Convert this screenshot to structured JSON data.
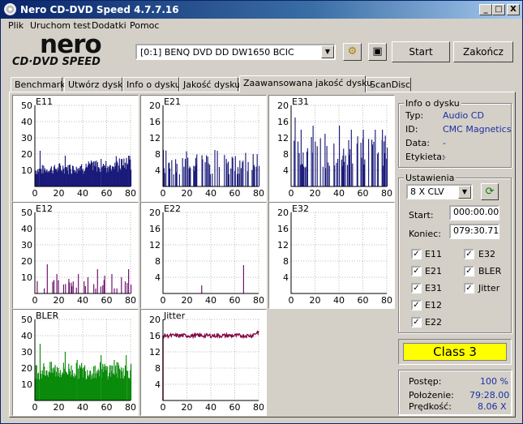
{
  "window": {
    "title": "Nero CD-DVD Speed 4.7.7.16"
  },
  "titlebar_buttons": {
    "minimize": "_",
    "maximize": "□",
    "close": "X"
  },
  "menu": [
    "Plik",
    "Uruchom test",
    "Dodatki",
    "Pomoc"
  ],
  "logo": {
    "line1": "nero",
    "line2": "CD·DVD SPEED"
  },
  "drive": {
    "selected": "[0:1]   BENQ DVD DD DW1650 BCIC"
  },
  "buttons": {
    "start": "Start",
    "finish": "Zakończ"
  },
  "tabs": [
    "Benchmark",
    "Utwórz dysk",
    "Info o dysku",
    "Jakość dysku",
    "Zaawansowana jakość dysku",
    "ScanDisc"
  ],
  "active_tab": 4,
  "disc_info": {
    "title": "Info o dysku",
    "rows": [
      {
        "label": "Typ:",
        "value": "Audio CD"
      },
      {
        "label": "ID:",
        "value": "CMC Magnetics"
      },
      {
        "label": "Data:",
        "value": "-"
      },
      {
        "label": "Etykieta:",
        "value": "-"
      }
    ]
  },
  "settings": {
    "title": "Ustawienia",
    "speed": "8 X CLV",
    "start_label": "Start:",
    "start_value": "000:00.00",
    "end_label": "Koniec:",
    "end_value": "079:30.71",
    "checks": [
      {
        "label": "E11",
        "checked": true
      },
      {
        "label": "E32",
        "checked": true
      },
      {
        "label": "E21",
        "checked": true
      },
      {
        "label": "BLER",
        "checked": true
      },
      {
        "label": "E31",
        "checked": true
      },
      {
        "label": "Jitter",
        "checked": true
      },
      {
        "label": "E12",
        "checked": true
      },
      {
        "label": "E22",
        "checked": true
      }
    ]
  },
  "class_result": "Class 3",
  "status": [
    {
      "label": "Postęp:",
      "value": "100 %"
    },
    {
      "label": "Położenie:",
      "value": "79:28.00"
    },
    {
      "label": "Prędkość:",
      "value": "8.06 X"
    }
  ],
  "colors": {
    "bar_navy": "#1a1a7a",
    "bar_purple": "#6a0a6a",
    "bar_green": "#0a8a0a",
    "jitter_line": "#800040",
    "class_bg": "#ffff00"
  },
  "chart_data": [
    {
      "type": "bar",
      "title": "E11",
      "color": "#1a1a7a",
      "xlim": [
        0,
        80
      ],
      "ylim": [
        0,
        50
      ],
      "xticks": [
        0,
        20,
        40,
        60,
        80
      ],
      "yticks": [
        10,
        20,
        30,
        40,
        50
      ],
      "pattern": {
        "base": 7,
        "spread": 6,
        "rise": 4,
        "spikes": [
          [
            4,
            22
          ],
          [
            25,
            19
          ],
          [
            55,
            17
          ],
          [
            78,
            19
          ]
        ]
      }
    },
    {
      "type": "bar",
      "title": "E21",
      "color": "#1a1a7a",
      "xlim": [
        0,
        80
      ],
      "ylim": [
        0,
        20
      ],
      "xticks": [
        0,
        20,
        40,
        60,
        80
      ],
      "yticks": [
        4,
        8,
        12,
        16,
        20
      ],
      "pattern": {
        "sparse": true,
        "base": 3,
        "spread": 6,
        "density": 0.35,
        "spikes": [
          [
            0,
            9
          ],
          [
            16,
            7
          ],
          [
            27,
            7
          ],
          [
            43,
            9
          ],
          [
            58,
            7
          ],
          [
            66,
            6
          ],
          [
            75,
            8
          ]
        ]
      }
    },
    {
      "type": "bar",
      "title": "E31",
      "color": "#1a1a7a",
      "xlim": [
        0,
        80
      ],
      "ylim": [
        0,
        20
      ],
      "xticks": [
        0,
        20,
        40,
        60,
        80
      ],
      "yticks": [
        4,
        8,
        12,
        16,
        20
      ],
      "pattern": {
        "sparse": true,
        "base": 4,
        "spread": 9,
        "density": 0.4,
        "spikes": [
          [
            3,
            17
          ],
          [
            8,
            14
          ],
          [
            18,
            15
          ],
          [
            28,
            13
          ],
          [
            40,
            15
          ],
          [
            50,
            14
          ],
          [
            60,
            14
          ],
          [
            70,
            14
          ],
          [
            76,
            14
          ]
        ]
      }
    },
    {
      "type": "bar",
      "title": "E12",
      "color": "#6a0a6a",
      "xlim": [
        0,
        80
      ],
      "ylim": [
        0,
        50
      ],
      "xticks": [
        0,
        20,
        40,
        60,
        80
      ],
      "yticks": [
        10,
        20,
        30,
        40,
        50
      ],
      "pattern": {
        "sparse": true,
        "base": 3,
        "spread": 6,
        "density": 0.15,
        "spikes": [
          [
            10,
            18
          ],
          [
            18,
            12
          ],
          [
            28,
            9
          ],
          [
            36,
            12
          ],
          [
            44,
            10
          ],
          [
            52,
            15
          ],
          [
            58,
            11
          ],
          [
            64,
            12
          ],
          [
            72,
            10
          ],
          [
            78,
            15
          ]
        ]
      }
    },
    {
      "type": "bar",
      "title": "E22",
      "color": "#6a0a6a",
      "xlim": [
        0,
        80
      ],
      "ylim": [
        0,
        20
      ],
      "xticks": [
        0,
        20,
        40,
        60,
        80
      ],
      "yticks": [
        4,
        8,
        12,
        16,
        20
      ],
      "pattern": {
        "sparse": true,
        "base": 0,
        "spread": 0,
        "density": 0,
        "spikes": [
          [
            32,
            2
          ],
          [
            67,
            7
          ]
        ]
      }
    },
    {
      "type": "bar",
      "title": "E32",
      "color": "#6a0a6a",
      "xlim": [
        0,
        80
      ],
      "ylim": [
        0,
        20
      ],
      "xticks": [
        0,
        20,
        40,
        60,
        80
      ],
      "yticks": [
        4,
        8,
        12,
        16,
        20
      ],
      "pattern": {
        "sparse": true,
        "base": 0,
        "spread": 0,
        "density": 0,
        "spikes": []
      }
    },
    {
      "type": "bar",
      "title": "BLER",
      "color": "#0a8a0a",
      "xlim": [
        0,
        80
      ],
      "ylim": [
        0,
        50
      ],
      "xticks": [
        0,
        20,
        40,
        60,
        80
      ],
      "yticks": [
        10,
        20,
        30,
        40,
        50
      ],
      "pattern": {
        "base": 13,
        "spread": 11,
        "rise": 0,
        "spikes": [
          [
            4,
            35
          ],
          [
            25,
            30
          ],
          [
            35,
            25
          ],
          [
            55,
            28
          ],
          [
            66,
            25
          ],
          [
            76,
            28
          ]
        ]
      }
    },
    {
      "type": "line",
      "title": "Jitter",
      "color": "#800040",
      "xlim": [
        0,
        80
      ],
      "ylim": [
        0,
        20
      ],
      "xticks": [
        0,
        20,
        40,
        60,
        80
      ],
      "yticks": [
        4,
        8,
        12,
        16,
        20
      ],
      "pattern": {
        "level": 16,
        "noise": 0.5,
        "end_rise": 1
      }
    }
  ]
}
